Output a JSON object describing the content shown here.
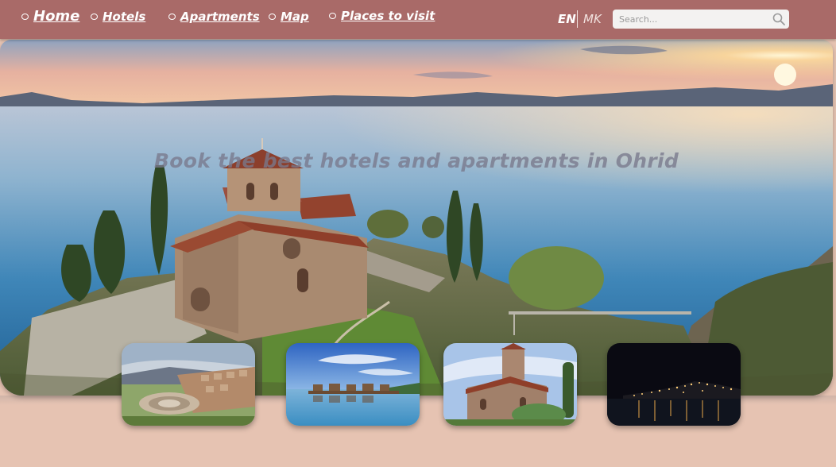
{
  "nav": {
    "items": [
      {
        "label": "Home",
        "active": true
      },
      {
        "label": "Hotels"
      },
      {
        "label": "Apartments"
      },
      {
        "label": "Map"
      },
      {
        "label": "Places to visit"
      }
    ],
    "languages": [
      "EN",
      "MK"
    ],
    "active_language": "EN",
    "search": {
      "placeholder": "Search...",
      "icon": "search-icon"
    }
  },
  "hero": {
    "tagline": "Book the best hotels and apartments in Ohrid"
  },
  "thumbnails": [
    {
      "name": "ancient-theatre-photo"
    },
    {
      "name": "bay-of-bones-photo"
    },
    {
      "name": "church-photo"
    },
    {
      "name": "ohrid-at-night-photo"
    }
  ],
  "colors": {
    "nav_background": "#a96a68",
    "page_background": "#e6c3b2",
    "nav_text": "#ffffff"
  }
}
